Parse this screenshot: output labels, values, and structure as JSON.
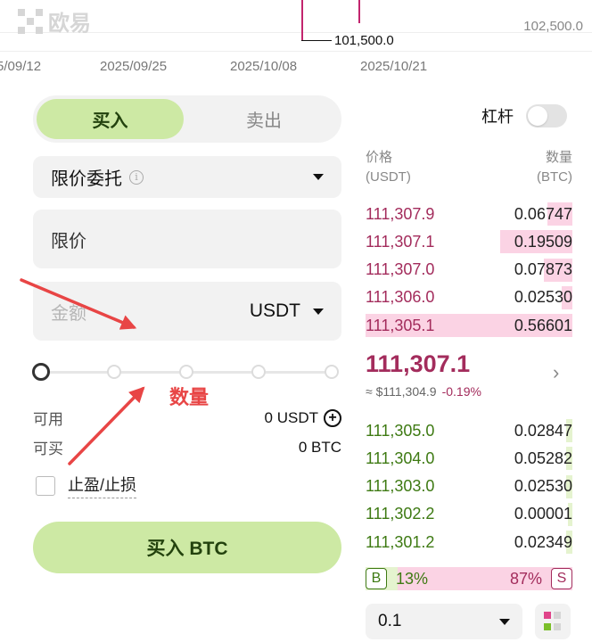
{
  "chart": {
    "logo_text": "欧易",
    "price_marker": "101,500.0",
    "axis_right": "102,500.0",
    "dates": [
      "5/09/12",
      "2025/09/25",
      "2025/10/08",
      "2025/10/21"
    ]
  },
  "order_form": {
    "side_buy": "买入",
    "side_sell": "卖出",
    "order_type": "限价委托",
    "price_placeholder": "限价",
    "amount_placeholder": "金额",
    "amount_unit": "USDT",
    "available_label": "可用",
    "available_value": "0 USDT",
    "can_buy_label": "可买",
    "can_buy_value": "0 BTC",
    "tpsl_label": "止盈/止损",
    "submit_label": "买入 BTC"
  },
  "annotation": {
    "text": "数量"
  },
  "orderbook": {
    "leverage_label": "杠杆",
    "price_header": "价格",
    "price_unit": "(USDT)",
    "qty_header": "数量",
    "qty_unit": "(BTC)",
    "asks": [
      {
        "price": "111,307.9",
        "qty": "0.06747",
        "depth": 0.12
      },
      {
        "price": "111,307.1",
        "qty": "0.19509",
        "depth": 0.35
      },
      {
        "price": "111,307.0",
        "qty": "0.07873",
        "depth": 0.14
      },
      {
        "price": "111,306.0",
        "qty": "0.02530",
        "depth": 0.05
      },
      {
        "price": "111,305.1",
        "qty": "0.56601",
        "depth": 1.0
      }
    ],
    "mid_price": "111,307.1",
    "mid_usd": "≈ $111,304.9",
    "mid_change": "-0.19%",
    "bids": [
      {
        "price": "111,305.0",
        "qty": "0.02847",
        "depth": 0.03
      },
      {
        "price": "111,304.0",
        "qty": "0.05282",
        "depth": 0.03
      },
      {
        "price": "111,303.0",
        "qty": "0.02530",
        "depth": 0.03
      },
      {
        "price": "111,302.2",
        "qty": "0.00001",
        "depth": 0.02
      },
      {
        "price": "111,301.2",
        "qty": "0.02349",
        "depth": 0.03
      }
    ],
    "buy_badge": "B",
    "sell_badge": "S",
    "buy_ratio": "13%",
    "sell_ratio": "87%",
    "precision": "0.1"
  },
  "colors": {
    "buy_green": "#cde9a4",
    "ask_red": "#a32c5c",
    "bid_green": "#3e7a13",
    "annotation_red": "#e84545"
  }
}
